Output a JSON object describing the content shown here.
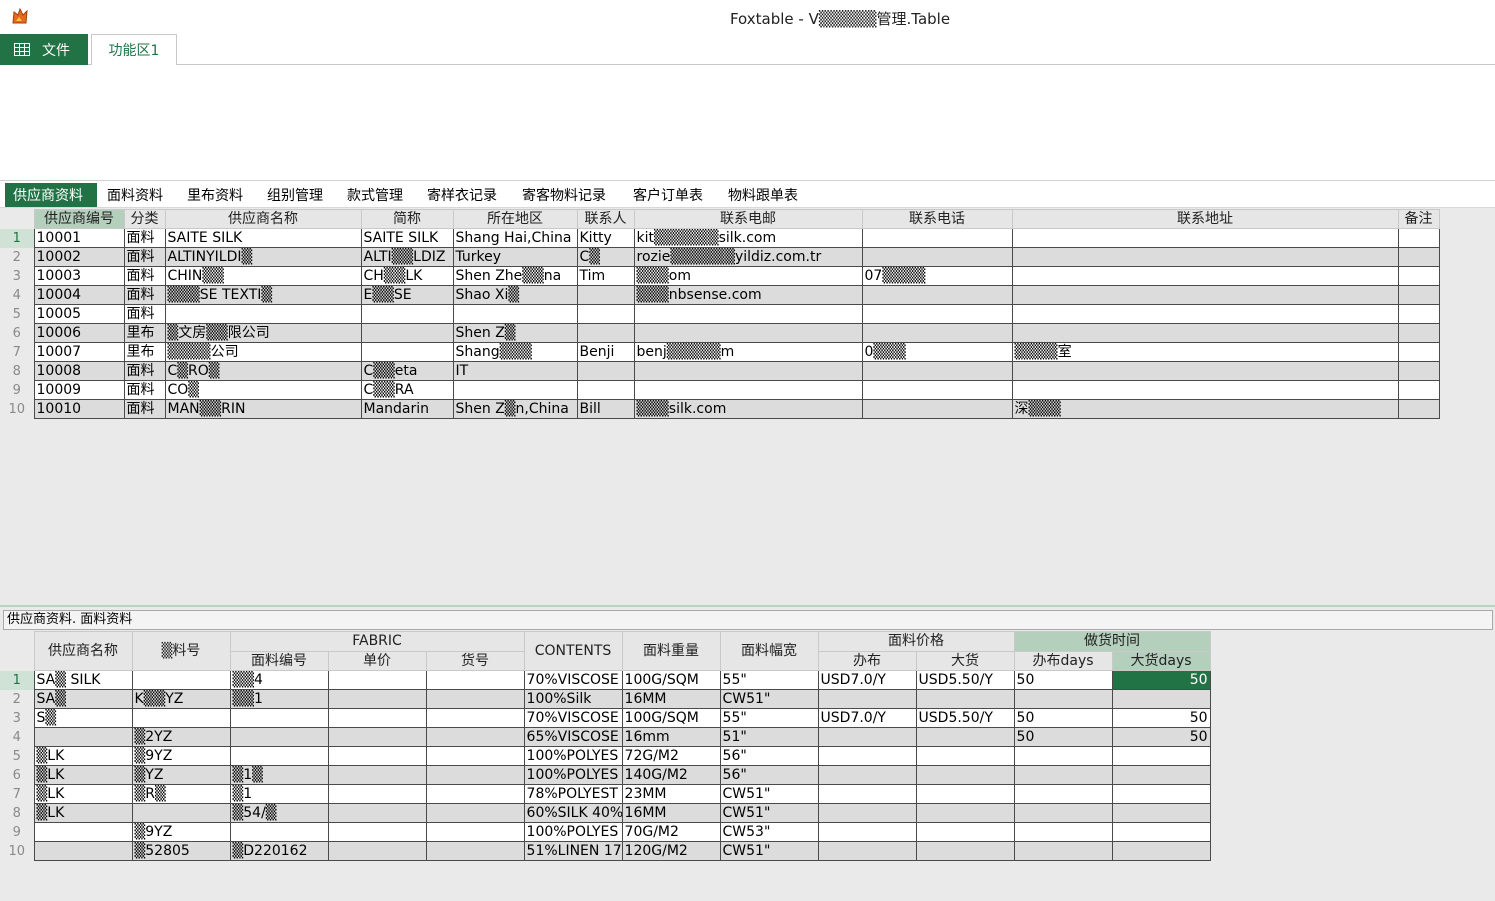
{
  "window": {
    "title": "Foxtable - V▒▒▒▒▒管理.Table"
  },
  "ribbon": {
    "file_tab": "文件",
    "func_tab": "功能区1"
  },
  "table_tabs": [
    "供应商资料",
    "面料资料",
    "里布资料",
    "组别管理",
    "款式管理",
    "寄样衣记录",
    "寄客物料记录",
    "客户订单表",
    "物料跟单表"
  ],
  "upper": {
    "headers": [
      "供应商编号",
      "分类",
      "供应商名称",
      "简称",
      "所在地区",
      "联系人",
      "联系电邮",
      "联系电话",
      "联系地址",
      "备注"
    ],
    "rows": [
      {
        "n": "1",
        "id": "10001",
        "cat": "面料",
        "name": "SAITE SILK",
        "short": "SAITE SILK",
        "region": "Shang Hai,China",
        "contact": "Kitty",
        "email": "kit▒▒▒▒▒▒silk.com",
        "phone": "",
        "addr": "",
        "note": ""
      },
      {
        "n": "2",
        "id": "10002",
        "cat": "面料",
        "name": "ALTINYILDI▒",
        "short": "ALTI▒▒LDIZ",
        "region": "Turkey",
        "contact": "C▒",
        "email": "rozie▒▒▒▒▒▒yildiz.com.tr",
        "phone": "",
        "addr": "",
        "note": ""
      },
      {
        "n": "3",
        "id": "10003",
        "cat": "面料",
        "name": "CHIN▒▒",
        "short": "CH▒▒LK",
        "region": "Shen Zhe▒▒na",
        "contact": "Tim",
        "email": "▒▒▒om",
        "phone": "07▒▒▒▒",
        "addr": "",
        "note": ""
      },
      {
        "n": "4",
        "id": "10004",
        "cat": "面料",
        "name": "▒▒▒SE TEXTI▒",
        "short": "E▒▒SE",
        "region": "Shao Xi▒",
        "contact": "",
        "email": "▒▒▒nbsense.com",
        "phone": "",
        "addr": "",
        "note": ""
      },
      {
        "n": "5",
        "id": "10005",
        "cat": "面料",
        "name": "",
        "short": "",
        "region": "",
        "contact": "",
        "email": "",
        "phone": "",
        "addr": "",
        "note": ""
      },
      {
        "n": "6",
        "id": "10006",
        "cat": "里布",
        "name": "▒文房▒▒限公司",
        "short": "",
        "region": "Shen Z▒",
        "contact": "",
        "email": "",
        "phone": "",
        "addr": "",
        "note": ""
      },
      {
        "n": "7",
        "id": "10007",
        "cat": "里布",
        "name": "▒▒▒▒公司",
        "short": "",
        "region": "Shang▒▒▒",
        "contact": "Benji",
        "email": "benj▒▒▒▒▒m",
        "phone": "0▒▒▒",
        "addr": "▒▒▒▒室",
        "note": ""
      },
      {
        "n": "8",
        "id": "10008",
        "cat": "面料",
        "name": "C▒RO▒",
        "short": "C▒▒eta",
        "region": "IT",
        "contact": "",
        "email": "",
        "phone": "",
        "addr": "",
        "note": ""
      },
      {
        "n": "9",
        "id": "10009",
        "cat": "面料",
        "name": "CO▒",
        "short": "C▒▒RA",
        "region": "",
        "contact": "",
        "email": "",
        "phone": "",
        "addr": "",
        "note": ""
      },
      {
        "n": "10",
        "id": "10010",
        "cat": "面料",
        "name": "MAN▒▒RIN",
        "short": "Mandarin",
        "region": "Shen Z▒n,China",
        "contact": "Bill",
        "email": "▒▒▒silk.com",
        "phone": "",
        "addr": "深▒▒▒",
        "note": ""
      }
    ]
  },
  "lower": {
    "title": "供应商资料. 面料资料",
    "headers": {
      "supplier": "供应商名称",
      "code": "▒料号",
      "fabric": "FABRIC",
      "fabric_no": "面料编号",
      "unit_price": "单价",
      "goods_no": "货号",
      "contents": "CONTENTS",
      "weight": "面料重量",
      "width": "面料幅宽",
      "price": "面料价格",
      "price_sample": "办布",
      "price_bulk": "大货",
      "lead": "做货时间",
      "lead_sample": "办布days",
      "lead_bulk": "大货days"
    },
    "rows": [
      {
        "n": "1",
        "supplier": "SA▒ SILK",
        "code": "",
        "fno": "▒▒4",
        "price": "",
        "goods": "",
        "contents": "70%VISCOSE",
        "weight": "100G/SQM",
        "width": "55\"",
        "ps": "USD7.0/Y",
        "pb": "USD5.50/Y",
        "ls": "50",
        "lb": "50"
      },
      {
        "n": "2",
        "supplier": "SA▒",
        "code": "K▒▒YZ",
        "fno": "▒▒1",
        "price": "",
        "goods": "",
        "contents": "100%Silk",
        "weight": "16MM",
        "width": "CW51\"",
        "ps": "",
        "pb": "",
        "ls": "",
        "lb": ""
      },
      {
        "n": "3",
        "supplier": "S▒",
        "code": "",
        "fno": "",
        "price": "",
        "goods": "",
        "contents": "70%VISCOSE",
        "weight": "100G/SQM",
        "width": "55\"",
        "ps": "USD7.0/Y",
        "pb": "USD5.50/Y",
        "ls": "50",
        "lb": "50"
      },
      {
        "n": "4",
        "supplier": "",
        "code": "▒2YZ",
        "fno": "",
        "price": "",
        "goods": "",
        "contents": "65%VISCOSE",
        "weight": "16mm",
        "width": "51\"",
        "ps": "",
        "pb": "",
        "ls": "50",
        "lb": "50"
      },
      {
        "n": "5",
        "supplier": "▒LK",
        "code": "▒9YZ",
        "fno": "",
        "price": "",
        "goods": "",
        "contents": "100%POLYES",
        "weight": "72G/M2",
        "width": "56\"",
        "ps": "",
        "pb": "",
        "ls": "",
        "lb": ""
      },
      {
        "n": "6",
        "supplier": "▒LK",
        "code": "▒YZ",
        "fno": "▒1▒",
        "price": "",
        "goods": "",
        "contents": "100%POLYES",
        "weight": "140G/M2",
        "width": "56\"",
        "ps": "",
        "pb": "",
        "ls": "",
        "lb": ""
      },
      {
        "n": "7",
        "supplier": "▒LK",
        "code": "▒R▒",
        "fno": "▒1",
        "price": "",
        "goods": "",
        "contents": "78%POLYEST",
        "weight": "23MM",
        "width": "CW51\"",
        "ps": "",
        "pb": "",
        "ls": "",
        "lb": ""
      },
      {
        "n": "8",
        "supplier": "▒LK",
        "code": "",
        "fno": "▒54/▒",
        "price": "",
        "goods": "",
        "contents": "60%SILK 40%V",
        "weight": "16MM",
        "width": "CW51\"",
        "ps": "",
        "pb": "",
        "ls": "",
        "lb": ""
      },
      {
        "n": "9",
        "supplier": "",
        "code": "▒9YZ",
        "fno": "",
        "price": "",
        "goods": "",
        "contents": "100%POLYES",
        "weight": "70G/M2",
        "width": "CW53\"",
        "ps": "",
        "pb": "",
        "ls": "",
        "lb": ""
      },
      {
        "n": "10",
        "supplier": "",
        "code": "▒52805",
        "fno": "▒D220162",
        "price": "",
        "goods": "",
        "contents": "51%LINEN 17.",
        "weight": "120G/M2",
        "width": "CW51\"",
        "ps": "",
        "pb": "",
        "ls": "",
        "lb": ""
      }
    ]
  },
  "colors": {
    "accent": "#217346",
    "header_highlight": "#b4cfbc",
    "grid_bg": "#eaeaea"
  }
}
